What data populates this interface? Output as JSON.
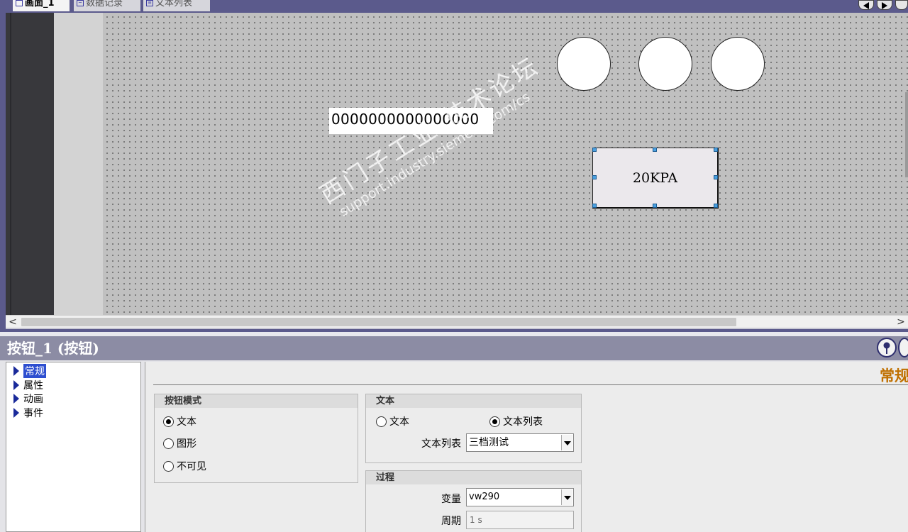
{
  "tabs": [
    {
      "label": "画面_1",
      "active": true
    },
    {
      "label": "数据记录",
      "active": false
    },
    {
      "label": "文本列表",
      "active": false
    }
  ],
  "canvas": {
    "io_field_value": "0000000000000000",
    "button_text": "20KPA",
    "watermark_line1": "西门子工业 技术论坛",
    "watermark_line2": "support.industry.siemens.com/cs"
  },
  "scrollbar": {
    "left_arrow": "<",
    "right_arrow": ">"
  },
  "panel": {
    "title": "按钮_1 (按钮)",
    "section_title": "常规",
    "tree": [
      {
        "label": "常规",
        "selected": true
      },
      {
        "label": "属性",
        "selected": false
      },
      {
        "label": "动画",
        "selected": false
      },
      {
        "label": "事件",
        "selected": false
      }
    ],
    "button_mode": {
      "heading": "按钮模式",
      "options": [
        {
          "label": "文本",
          "checked": true
        },
        {
          "label": "图形",
          "checked": false
        },
        {
          "label": "不可见",
          "checked": false
        }
      ]
    },
    "text_group": {
      "heading": "文本",
      "option_text": "文本",
      "option_textlist": "文本列表",
      "textlist_label": "文本列表",
      "textlist_value": "三档测试"
    },
    "process_group": {
      "heading": "过程",
      "variable_label": "变量",
      "variable_value": "vw290",
      "cycle_label": "周期",
      "cycle_value": "1 s"
    }
  },
  "colors": {
    "frame": "#5b5a8c",
    "canvas": "#c0c0c0",
    "section_title": "#c07000",
    "tree_selection": "#2e4fd0"
  }
}
